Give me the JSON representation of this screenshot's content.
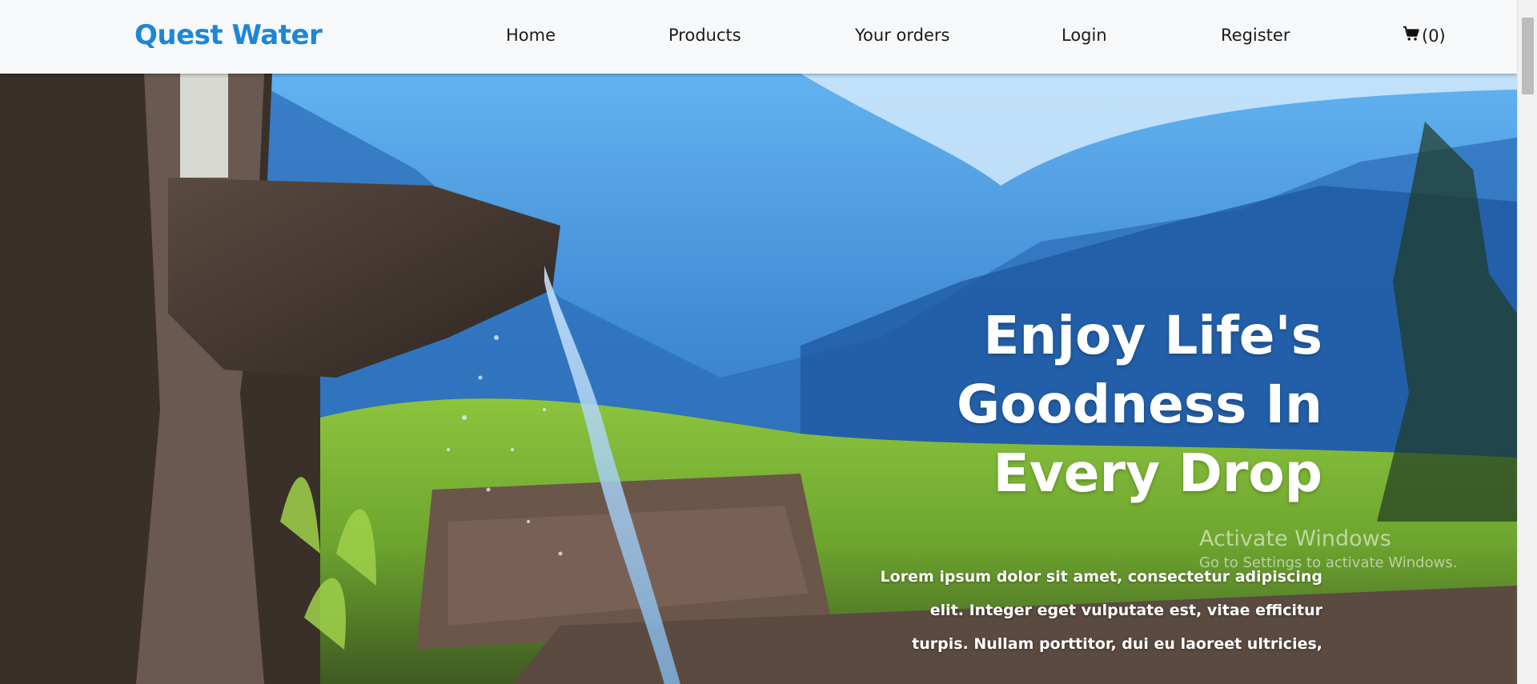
{
  "navbar": {
    "brand": "Quest Water",
    "links": [
      "Home",
      "Products",
      "Your orders",
      "Login",
      "Register"
    ],
    "cart_label": "(0)",
    "cart_icon": "cart-icon"
  },
  "hero": {
    "headline_lines": [
      "Enjoy Life's",
      "Goodness In",
      "Every Drop"
    ],
    "description": "Lorem ipsum dolor sit amet, consectetur adipiscing elit. Integer eget vulputate est, vitae efficitur turpis. Nullam porttitor, dui eu laoreet ultricies,"
  },
  "watermark": {
    "title": "Activate Windows",
    "subtitle": "Go to Settings to activate Windows."
  },
  "colors": {
    "brand": "#1e86d6",
    "navbar_bg": "#f6f8fa",
    "nav_text": "#1b1b1b",
    "hero_text": "#ffffff"
  }
}
